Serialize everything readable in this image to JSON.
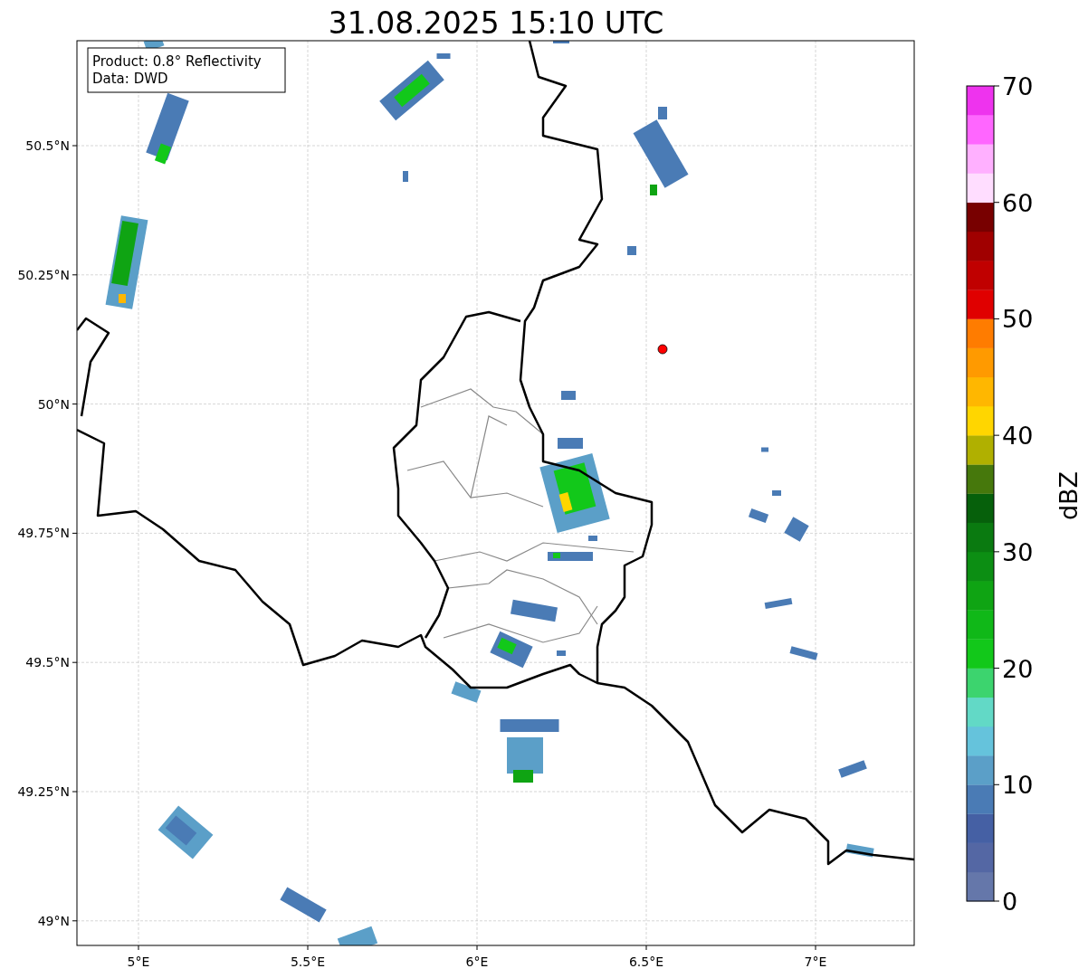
{
  "title": "31.08.2025 15:10 UTC",
  "info_box": {
    "lines": [
      "Product: 0.8° Reflectivity",
      "Data: DWD"
    ]
  },
  "map": {
    "x_ticks": [
      "5°E",
      "5.5°E",
      "6°E",
      "6.5°E",
      "7°E"
    ],
    "y_ticks": [
      "50.5°N",
      "50.25°N",
      "50°N",
      "49.75°N",
      "49.5°N",
      "49.25°N",
      "49°N"
    ]
  },
  "colorbar": {
    "label": "dBZ",
    "ticks": [
      "70",
      "60",
      "50",
      "40",
      "30",
      "20",
      "10",
      "0"
    ],
    "bins": [
      {
        "color": "#6577aa"
      },
      {
        "color": "#5467a4"
      },
      {
        "color": "#4560a4"
      },
      {
        "color": "#4a7bb5"
      },
      {
        "color": "#5b9fc8"
      },
      {
        "color": "#65c3dc"
      },
      {
        "color": "#62d9c6"
      },
      {
        "color": "#3cd46e"
      },
      {
        "color": "#12c81a"
      },
      {
        "color": "#10b818"
      },
      {
        "color": "#0fa413"
      },
      {
        "color": "#0c8e13"
      },
      {
        "color": "#0a7a10"
      },
      {
        "color": "#06600b"
      },
      {
        "color": "#46780c"
      },
      {
        "color": "#b0b000"
      },
      {
        "color": "#ffd600"
      },
      {
        "color": "#ffb700"
      },
      {
        "color": "#ff9a00"
      },
      {
        "color": "#ff7c00"
      },
      {
        "color": "#e00000"
      },
      {
        "color": "#c00000"
      },
      {
        "color": "#a00000"
      },
      {
        "color": "#780000"
      },
      {
        "color": "#ffddff"
      },
      {
        "color": "#ffb0ff"
      },
      {
        "color": "#ff66ff"
      },
      {
        "color": "#ee33ee"
      }
    ]
  }
}
